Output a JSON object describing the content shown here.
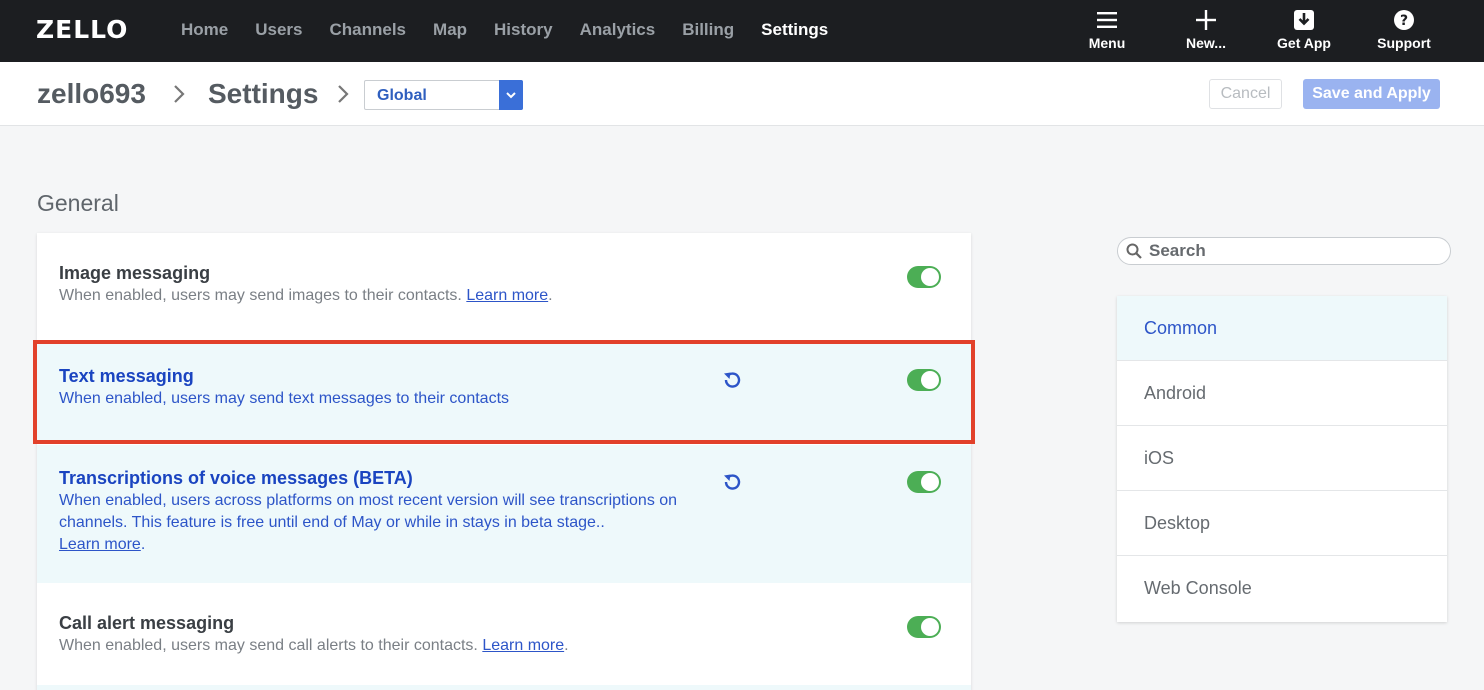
{
  "app": {
    "logo": "ZELLO",
    "nav": [
      "Home",
      "Users",
      "Channels",
      "Map",
      "History",
      "Analytics",
      "Billing",
      "Settings"
    ],
    "active_nav": "Settings",
    "actions": [
      {
        "label": "Menu",
        "icon": "hamburger-icon"
      },
      {
        "label": "New...",
        "icon": "plus-icon"
      },
      {
        "label": "Get App",
        "icon": "download-icon"
      },
      {
        "label": "Support",
        "icon": "help-icon"
      }
    ]
  },
  "subheader": {
    "account": "zello693",
    "page": "Settings",
    "scope_select": "Global",
    "cancel_label": "Cancel",
    "save_label": "Save and Apply"
  },
  "section": {
    "title": "General",
    "settings": [
      {
        "title": "Image messaging",
        "desc": "When enabled, users may send images to their contacts. ",
        "link": "Learn more",
        "tail": ".",
        "enabled": true,
        "modified": false
      },
      {
        "title": "Text messaging",
        "desc": "When enabled, users may send text messages to their contacts",
        "enabled": true,
        "modified": true,
        "highlighted": true
      },
      {
        "title": "Transcriptions of voice messages (BETA)",
        "desc_line1": "When enabled, users across platforms on most recent version will see transcriptions on",
        "desc_line2": "channels. This feature is free until end of May or while in stays in beta stage..",
        "link": "Learn more",
        "tail": ".",
        "enabled": true,
        "modified": true
      },
      {
        "title": "Call alert messaging",
        "desc": "When enabled, users may send call alerts to their contacts. ",
        "link": "Learn more",
        "tail": ".",
        "enabled": true,
        "modified": false
      }
    ]
  },
  "sidebar": {
    "search_placeholder": "Search",
    "items": [
      "Common",
      "Android",
      "iOS",
      "Desktop",
      "Web Console"
    ],
    "active": "Common"
  },
  "colors": {
    "topbar": "#1c1e21",
    "toggle_on": "#4cae55",
    "accent_blue": "#2d55c8",
    "highlight_border": "#e2412b",
    "modified_row_bg": "#eef9fb"
  }
}
